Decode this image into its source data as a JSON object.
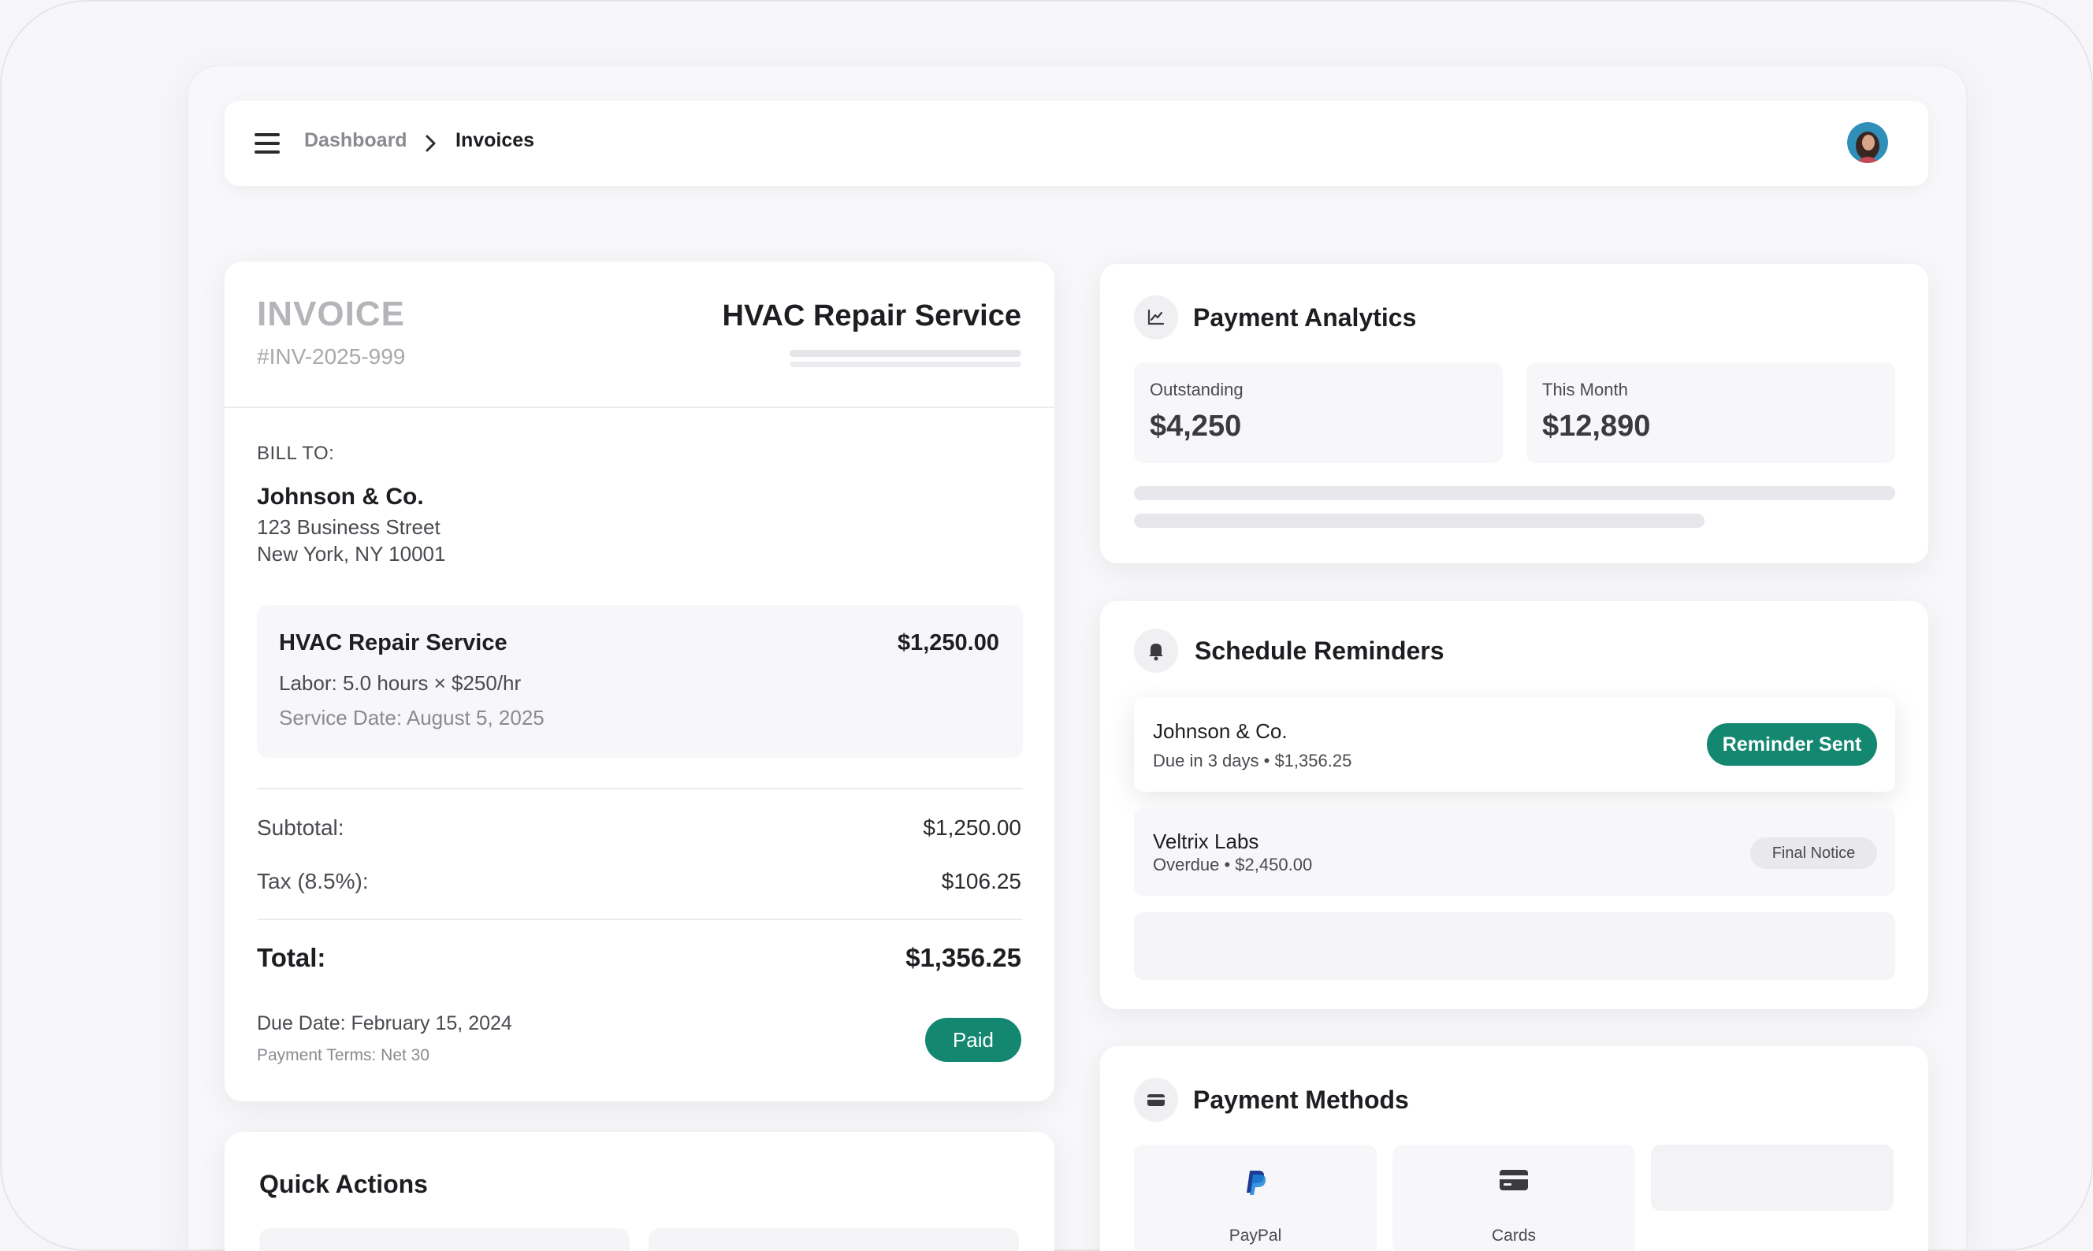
{
  "breadcrumb": {
    "parent": "Dashboard",
    "current": "Invoices"
  },
  "invoice": {
    "title": "INVOICE",
    "number": "#INV-2025-999",
    "service_title": "HVAC Repair Service",
    "bill_to_label": "BILL TO:",
    "bill_to_name": "Johnson & Co.",
    "address_line1": "123 Business Street",
    "address_line2": "New York, NY 10001",
    "line_item": {
      "name": "HVAC Repair Service",
      "amount": "$1,250.00",
      "labor": "Labor: 5.0 hours × $250/hr",
      "service_date": "Service Date: August 5, 2025"
    },
    "subtotal_label": "Subtotal:",
    "subtotal_value": "$1,250.00",
    "tax_label": "Tax (8.5%):",
    "tax_value": "$106.25",
    "total_label": "Total:",
    "total_value": "$1,356.25",
    "due_date": "Due Date: February 15, 2024",
    "payment_terms": "Payment Terms: Net 30",
    "status": "Paid"
  },
  "quick_actions": {
    "title": "Quick Actions"
  },
  "analytics": {
    "title": "Payment Analytics",
    "outstanding_label": "Outstanding",
    "outstanding_value": "$4,250",
    "month_label": "This Month",
    "month_value": "$12,890"
  },
  "reminders": {
    "title": "Schedule Reminders",
    "items": [
      {
        "name": "Johnson & Co.",
        "detail": "Due in 3 days • $1,356.25",
        "action": "Reminder Sent"
      },
      {
        "name": "Veltrix Labs",
        "detail": "Overdue • $2,450.00",
        "action": "Final Notice"
      }
    ]
  },
  "payment_methods": {
    "title": "Payment Methods",
    "items": [
      {
        "label": "PayPal",
        "icon": "paypal-icon"
      },
      {
        "label": "Cards",
        "icon": "credit-card-icon"
      }
    ]
  },
  "colors": {
    "accent": "#138770",
    "background": "#f7f7f9",
    "card": "#ffffff"
  }
}
